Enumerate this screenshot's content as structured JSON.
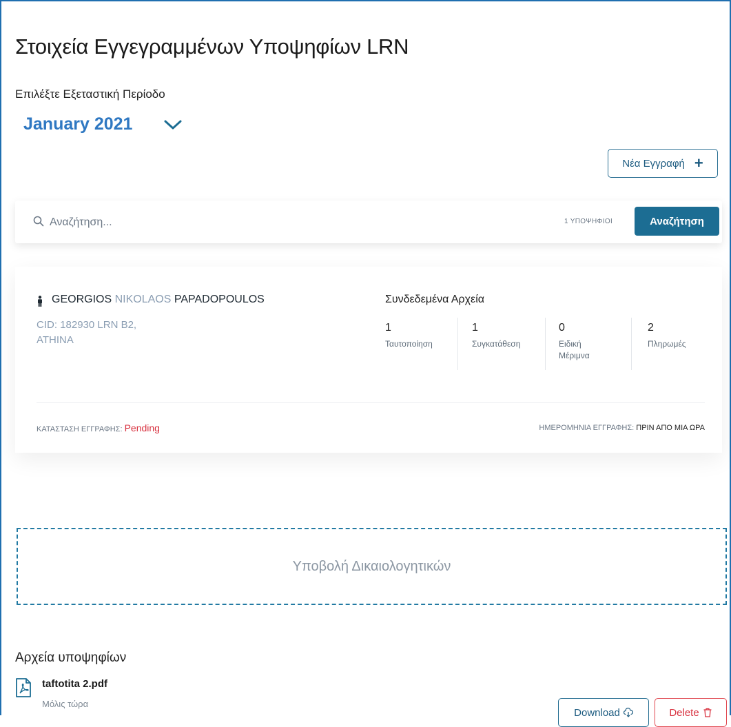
{
  "page": {
    "title": "Στοιχεία Εγγεγραμμένων Υποψηφίων LRN"
  },
  "period": {
    "label": "Επιλέξτε Εξεταστική Περίοδο",
    "selected": "January 2021"
  },
  "actions": {
    "new_registration": "Νέα Εγγραφή"
  },
  "search": {
    "placeholder": "Αναζήτηση...",
    "count": "1 ΥΠΟΨΗΦΙΟΙ",
    "button": "Αναζήτηση"
  },
  "candidate": {
    "first_name": "GEORGIOS",
    "middle_name": "NIKOLAOS",
    "last_name": "PAPADOPOULOS",
    "cid_line": "CID: 182930 LRN B2,",
    "city": "ATHINA",
    "linked_files_title": "Συνδεδεμένα Αρχεία",
    "stats": [
      {
        "value": "1",
        "label": "Ταυτοποίηση"
      },
      {
        "value": "1",
        "label": "Συγκατάθεση"
      },
      {
        "value": "0",
        "label_line1": "Ειδική",
        "label_line2": "Μέριμνα"
      },
      {
        "value": "2",
        "label": "Πληρωμές"
      }
    ],
    "status_label": "ΚΑΤΑΣΤΑΣΗ ΕΓΓΡΑΦΗΣ:",
    "status_value": "Pending",
    "date_label": "ΗΜΕΡΟΜΗΝΙΑ ΕΓΓΡΑΦΗΣ:",
    "date_value": "ΠΡΙΝ ΑΠΟ ΜΙΑ ΩΡΑ"
  },
  "upload": {
    "label": "Υποβολή Δικαιολογητικών"
  },
  "files": {
    "heading": "Αρχεία υποψηφίων",
    "items": [
      {
        "name": "taftotita 2.pdf",
        "time": "Μόλις τώρα",
        "download_label": "Download",
        "delete_label": "Delete"
      }
    ]
  },
  "colors": {
    "accent": "#1c6d93",
    "period": "#2f78c2",
    "pending": "#d8313f",
    "frame": "#1f6fb0"
  },
  "icons": [
    "chevron-down-icon",
    "plus-icon",
    "search-icon",
    "person-icon",
    "pdf-file-icon",
    "cloud-download-icon",
    "trash-icon"
  ]
}
